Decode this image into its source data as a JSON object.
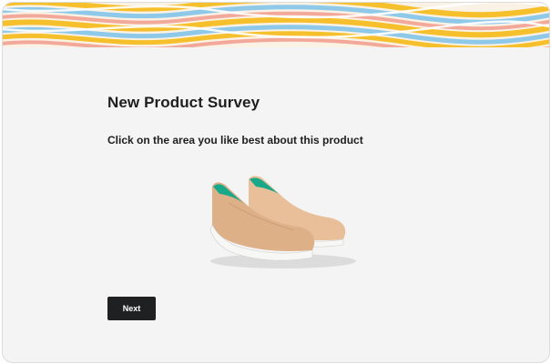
{
  "survey": {
    "title": "New Product Survey",
    "question": "Click on the area you like best about this product",
    "product_image": "tan-slip-on-sneakers"
  },
  "actions": {
    "next_label": "Next"
  },
  "colors": {
    "banner_waves": [
      "#f6c02c",
      "#8fc9ea",
      "#f3a99a",
      "#ffffff"
    ],
    "background": "#f4f4f4",
    "button": "#1f2022"
  }
}
